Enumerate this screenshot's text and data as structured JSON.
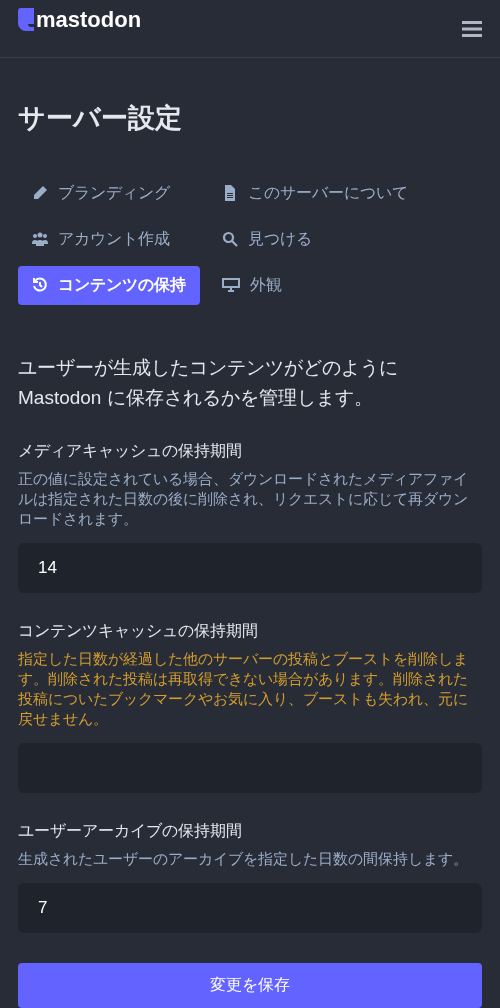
{
  "header": {
    "logo": "mastodon"
  },
  "title": "サーバー設定",
  "nav": [
    {
      "label": "ブランディング",
      "selected": false
    },
    {
      "label": "このサーバーについて",
      "selected": false
    },
    {
      "label": "アカウント作成",
      "selected": false
    },
    {
      "label": "見つける",
      "selected": false
    },
    {
      "label": "コンテンツの保持",
      "selected": true
    },
    {
      "label": "外観",
      "selected": false
    }
  ],
  "intro": "ユーザーが生成したコンテンツがどのように Mastodon に保存されるかを管理します。",
  "fields": [
    {
      "label": "メディアキャッシュの保持期間",
      "hint": "正の値に設定されている場合、ダウンロードされたメディアファイルは指定された日数の後に削除され、リクエストに応じて再ダウンロードされます。",
      "kind": "normal",
      "value": "14"
    },
    {
      "label": "コンテンツキャッシュの保持期間",
      "hint": "指定した日数が経過した他のサーバーの投稿とブーストを削除します。削除された投稿は再取得できない場合があります。削除された投稿についたブックマークやお気に入り、ブーストも失われ、元に戻せません。",
      "kind": "warning"
    },
    {
      "label": "ユーザーアーカイブの保持期間",
      "hint": "生成されたユーザーのアーカイブを指定した日数の間保持します。",
      "kind": "normal",
      "value": "7"
    }
  ],
  "save_button": "変更を保存"
}
